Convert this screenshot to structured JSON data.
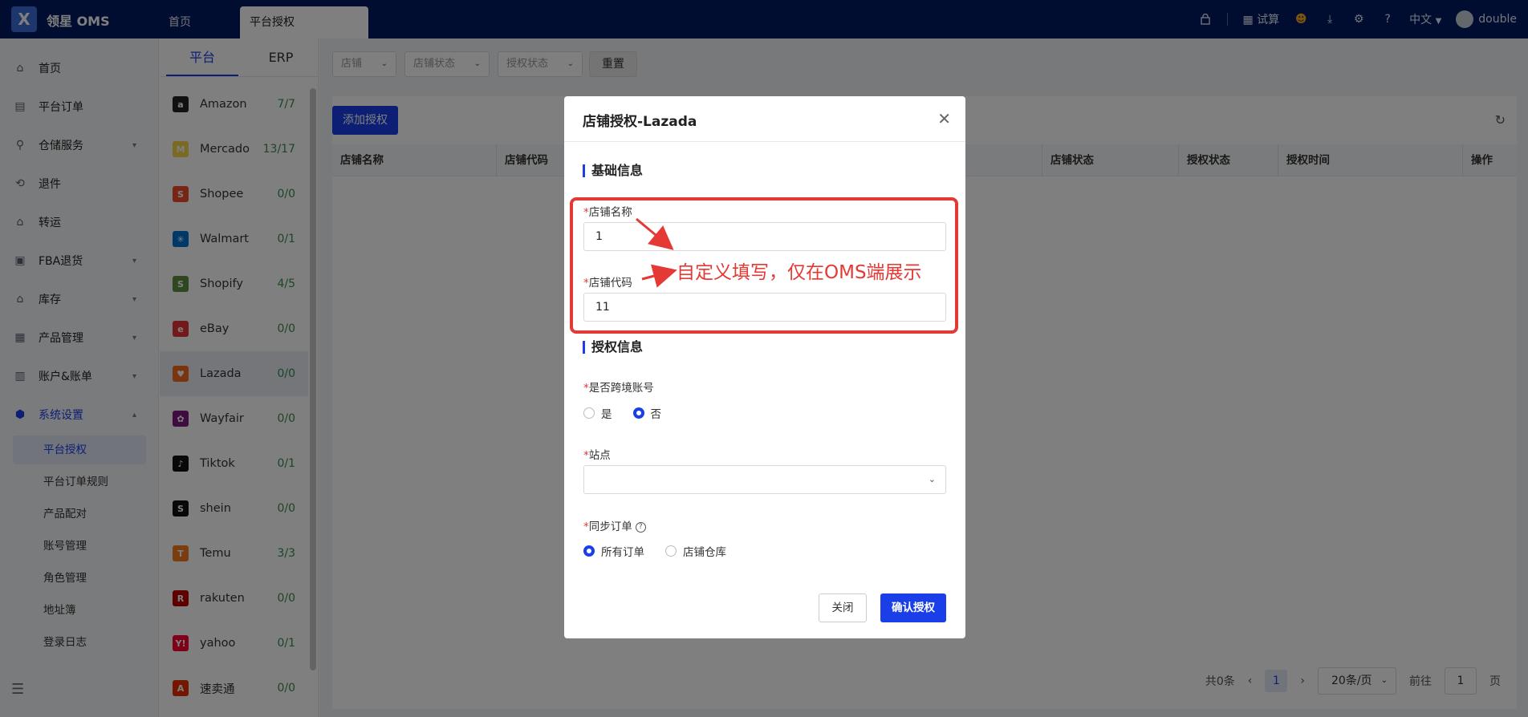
{
  "app": {
    "logo_letter": "X",
    "title": "领星 OMS"
  },
  "top_tabs": [
    {
      "label": "首页"
    },
    {
      "label": "平台授权"
    }
  ],
  "topbar_right": {
    "trial_label": "试算",
    "language": "中文",
    "username": "double"
  },
  "sidebar": {
    "items": [
      {
        "label": "首页",
        "icon": "home-icon"
      },
      {
        "label": "平台订单",
        "icon": "order-icon"
      },
      {
        "label": "仓储服务",
        "icon": "warehouse-icon"
      },
      {
        "label": "退件",
        "icon": "return-icon"
      },
      {
        "label": "转运",
        "icon": "transfer-icon"
      },
      {
        "label": "FBA退货",
        "icon": "fba-icon"
      },
      {
        "label": "库存",
        "icon": "inventory-icon"
      },
      {
        "label": "产品管理",
        "icon": "product-icon"
      },
      {
        "label": "账户&账单",
        "icon": "account-icon"
      },
      {
        "label": "系统设置",
        "icon": "settings-icon"
      }
    ],
    "sub_items": [
      {
        "label": "平台授权"
      },
      {
        "label": "平台订单规则"
      },
      {
        "label": "产品配对"
      },
      {
        "label": "账号管理"
      },
      {
        "label": "角色管理"
      },
      {
        "label": "地址簿"
      },
      {
        "label": "登录日志"
      }
    ]
  },
  "platform_panel": {
    "tabs": [
      {
        "label": "平台"
      },
      {
        "label": "ERP"
      }
    ],
    "platforms": [
      {
        "name": "Amazon",
        "count": "7/7",
        "color": "#222222",
        "glyph": "a"
      },
      {
        "name": "Mercado",
        "count": "13/17",
        "color": "#f5d547",
        "glyph": "M"
      },
      {
        "name": "Shopee",
        "count": "0/0",
        "color": "#ee4d2d",
        "glyph": "S"
      },
      {
        "name": "Walmart",
        "count": "0/1",
        "color": "#0071ce",
        "glyph": "✳"
      },
      {
        "name": "Shopify",
        "count": "4/5",
        "color": "#5e8e3e",
        "glyph": "S"
      },
      {
        "name": "eBay",
        "count": "0/0",
        "color": "#e53238",
        "glyph": "e"
      },
      {
        "name": "Lazada",
        "count": "0/0",
        "color": "#f36b21",
        "glyph": "♥"
      },
      {
        "name": "Wayfair",
        "count": "0/0",
        "color": "#7f187f",
        "glyph": "✿"
      },
      {
        "name": "Tiktok",
        "count": "0/1",
        "color": "#111111",
        "glyph": "♪"
      },
      {
        "name": "shein",
        "count": "0/0",
        "color": "#111111",
        "glyph": "S"
      },
      {
        "name": "Temu",
        "count": "3/3",
        "color": "#f47b20",
        "glyph": "T"
      },
      {
        "name": "rakuten",
        "count": "0/0",
        "color": "#bf0000",
        "glyph": "R"
      },
      {
        "name": "yahoo",
        "count": "0/1",
        "color": "#ff0033",
        "glyph": "Y!"
      },
      {
        "name": "速卖通",
        "count": "0/0",
        "color": "#e62e04",
        "glyph": "A"
      }
    ]
  },
  "filters": [
    {
      "placeholder": "店铺"
    },
    {
      "placeholder": "店铺状态"
    },
    {
      "placeholder": "授权状态"
    }
  ],
  "reset_label": "重置",
  "add_auth_label": "添加授权",
  "table": {
    "columns": [
      "店铺名称",
      "店铺代码",
      "店铺状态",
      "授权状态",
      "授权时间",
      "操作"
    ]
  },
  "pagination": {
    "total": "共0条",
    "current_page": "1",
    "page_size": "20条/页",
    "jump_prefix": "前往",
    "jump_value": "1",
    "jump_suffix": "页"
  },
  "modal": {
    "title": "店铺授权-Lazada",
    "section_basic": "基础信息",
    "store_name_label": "店铺名称",
    "store_name_value": "1",
    "store_code_label": "店铺代码",
    "store_code_value": "11",
    "section_auth": "授权信息",
    "cross_border_label": "是否跨境账号",
    "cross_border_options": [
      "是",
      "否"
    ],
    "cross_border_selected": "否",
    "site_label": "站点",
    "site_value": "",
    "sync_label": "同步订单",
    "sync_options": [
      "所有订单",
      "店铺仓库"
    ],
    "sync_selected": "所有订单",
    "close_label": "关闭",
    "confirm_label": "确认授权"
  },
  "annotation": {
    "text": "自定义填写，仅在OMS端展示",
    "color": "#e53935"
  },
  "colors": {
    "primary": "#1a3ee8",
    "topbar": "#001a61",
    "count_green": "#3a8a4a"
  }
}
